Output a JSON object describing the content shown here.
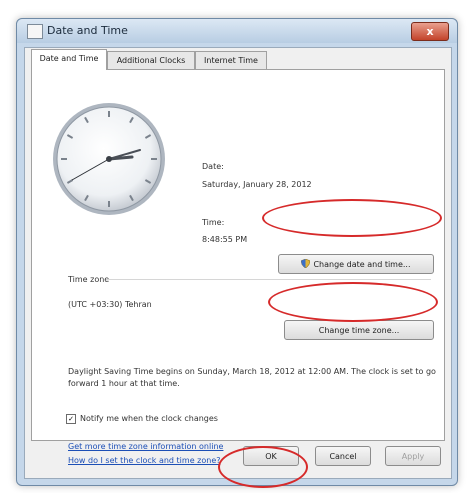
{
  "window": {
    "title": "Date and Time",
    "close_symbol": "x"
  },
  "tabs": [
    {
      "label": "Date and Time"
    },
    {
      "label": "Additional Clocks"
    },
    {
      "label": "Internet Time"
    }
  ],
  "date": {
    "label": "Date:",
    "value": "Saturday, January 28, 2012"
  },
  "time": {
    "label": "Time:",
    "value": "8:48:55 PM"
  },
  "buttons": {
    "change_date_time": "Change date and time...",
    "change_time_zone": "Change time zone...",
    "ok": "OK",
    "cancel": "Cancel",
    "apply": "Apply"
  },
  "timezone": {
    "section_label": "Time zone",
    "value": "(UTC +03:30) Tehran",
    "dst_note": "Daylight Saving Time begins on Sunday, March 18, 2012 at 12:00 AM. The clock is set to go forward 1 hour at that time."
  },
  "notify": {
    "label": "Notify me when the clock changes",
    "checked": true
  },
  "links": {
    "more_info": "Get more time zone information online",
    "how_to": "How do I set the clock and time zone?"
  },
  "colors": {
    "highlight_ring": "#d62a2a",
    "link": "#1c4fb6",
    "window_frame": "#c5d7ea"
  },
  "icons": {
    "title": "window-icon",
    "change_date_time": "shield-icon",
    "clock": "analog-clock-icon"
  }
}
